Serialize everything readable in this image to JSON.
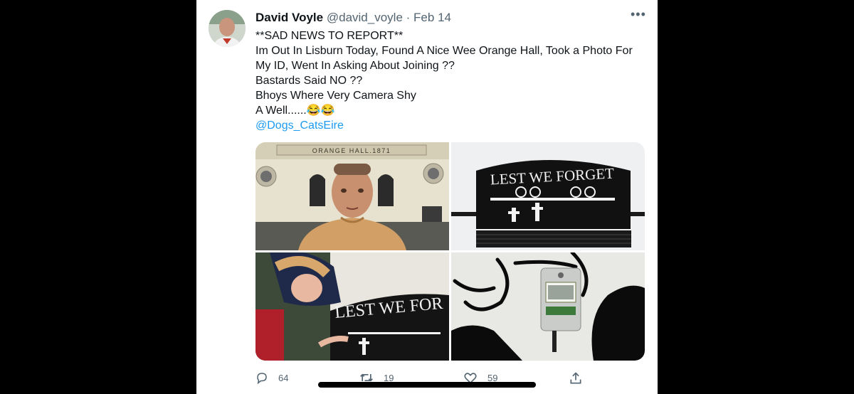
{
  "tweet": {
    "author_name": "David Voyle",
    "handle": "@david_voyle",
    "separator": "·",
    "date": "Feb 14",
    "more_label": "•••",
    "lines": [
      "**SAD NEWS TO REPORT**",
      "Im Out In Lisburn Today, Found A Nice Wee Orange Hall, Took a Photo For",
      "My ID, Went In Asking About Joining  ??",
      "Bastards Said NO ??",
      "Bhoys Where Very Camera Shy",
      "A Well......😂😂"
    ],
    "mention": "@Dogs_CatsEire"
  },
  "photos": {
    "hall_sign": "ORANGE HALL.1871",
    "bench_text_1": "LEST WE FORGET",
    "bench_text_2": "LEST WE FOR"
  },
  "actions": {
    "replies": "64",
    "retweets": "19",
    "likes": "59"
  },
  "colors": {
    "accent": "#1d9bf0",
    "muted": "#536471",
    "text": "#0f1419"
  },
  "icons": [
    "more-icon",
    "reply-icon",
    "retweet-icon",
    "like-icon",
    "share-icon"
  ]
}
